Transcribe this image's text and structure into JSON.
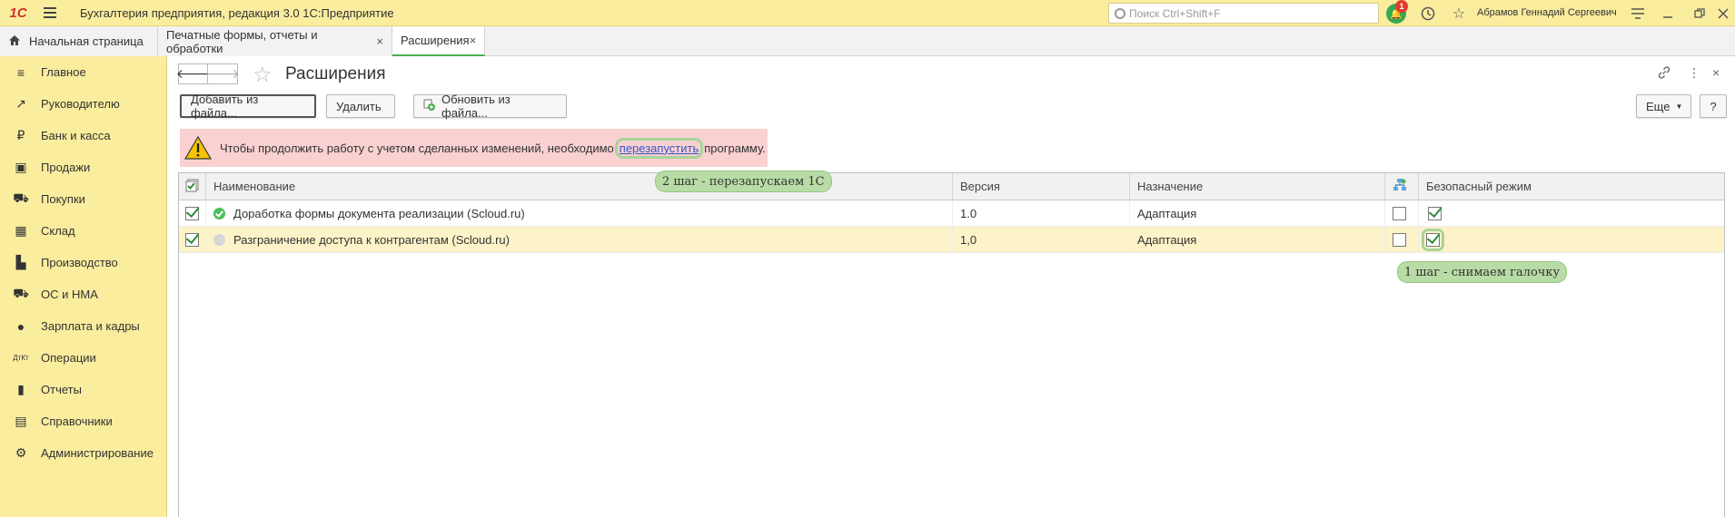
{
  "titlebar": {
    "logo": "1С",
    "title": "Бухгалтерия предприятия, редакция 3.0 1С:Предприятие",
    "search_placeholder": "Поиск Ctrl+Shift+F",
    "notification_count": "1",
    "user": "Абрамов Геннадий Сергеевич"
  },
  "tabs": {
    "home": "Начальная страница",
    "print": "Печатные формы, отчеты и обработки",
    "active": "Расширения",
    "close": "×"
  },
  "sidebar": {
    "items": [
      {
        "label": "Главное",
        "icon": "≡"
      },
      {
        "label": "Руководителю",
        "icon": "↗"
      },
      {
        "label": "Банк и касса",
        "icon": "₽"
      },
      {
        "label": "Продажи",
        "icon": "▣"
      },
      {
        "label": "Покупки",
        "icon": "⛟"
      },
      {
        "label": "Склад",
        "icon": "▦"
      },
      {
        "label": "Производство",
        "icon": "▙"
      },
      {
        "label": "ОС и НМА",
        "icon": "⛟"
      },
      {
        "label": "Зарплата и кадры",
        "icon": "●"
      },
      {
        "label": "Операции",
        "icon": "ДтКт"
      },
      {
        "label": "Отчеты",
        "icon": "▮"
      },
      {
        "label": "Справочники",
        "icon": "▤"
      },
      {
        "label": "Администрирование",
        "icon": "⚙"
      }
    ]
  },
  "page": {
    "title": "Расширения",
    "more_icon": "⋮",
    "close_icon": "×"
  },
  "toolbar": {
    "add_from_file": "Добавить из файла...",
    "delete": "Удалить",
    "update_from_file": "Обновить из файла...",
    "more": "Еще",
    "help": "?"
  },
  "warning": {
    "text_before": "Чтобы продолжить работу с учетом сделанных изменений, необходимо",
    "link": "перезапустить",
    "text_after": "программу."
  },
  "table": {
    "columns": {
      "name": "Наименование",
      "version": "Версия",
      "purpose": "Назначение",
      "safe_mode": "Безопасный режим"
    },
    "rows": [
      {
        "active": true,
        "status": "green",
        "name": "Доработка формы документа реализации (Scloud.ru)",
        "version": "1.0",
        "purpose": "Адаптация",
        "flag": false,
        "safe_mode": true
      },
      {
        "active": true,
        "status": "gray",
        "name": "Разграничение доступа к контрагентам (Scloud.ru)",
        "version": "1,0",
        "purpose": "Адаптация",
        "flag": false,
        "safe_mode": true
      }
    ]
  },
  "annotations": {
    "step2": "2 шаг - перезапускаем 1С",
    "step1": "1 шаг - снимаем галочку"
  },
  "colors": {
    "accent_yellow": "#fbed9e",
    "warning_bg": "#f9d1d1",
    "annotation_green": "#b8dca5",
    "link_blue": "#3456c8"
  }
}
